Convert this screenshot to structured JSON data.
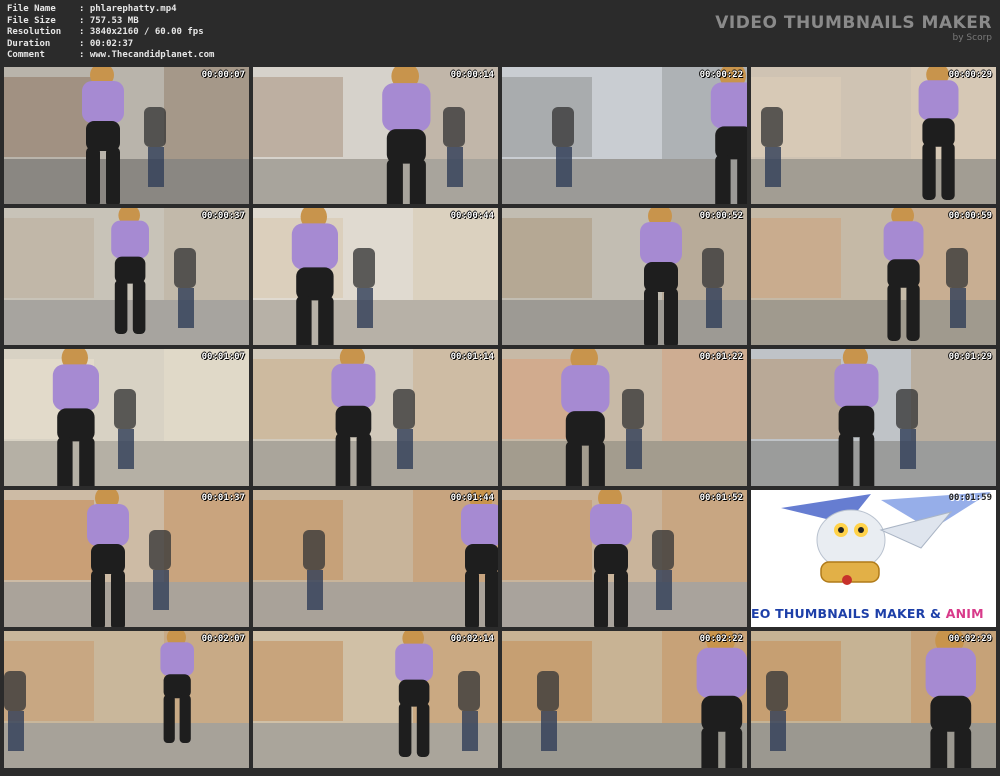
{
  "info": {
    "rows": [
      {
        "key": "File Name",
        "sep": ":",
        "value": "phlarephatty.mp4"
      },
      {
        "key": "File Size",
        "sep": ":",
        "value": "757.53 MB"
      },
      {
        "key": "Resolution",
        "sep": ":",
        "value": "3840x2160 / 60.00 fps"
      },
      {
        "key": "Duration",
        "sep": ":",
        "value": "00:02:37"
      },
      {
        "key": "Comment",
        "sep": ":",
        "value": "www.Thecandidplanet.com"
      }
    ]
  },
  "brand": {
    "title": "VIDEO THUMBNAILS MAKER",
    "subtitle": "by Scorp"
  },
  "thumbnails": [
    {
      "ts": "00:00:07"
    },
    {
      "ts": "00:00:14"
    },
    {
      "ts": "00:00:22"
    },
    {
      "ts": "00:00:29"
    },
    {
      "ts": "00:00:37"
    },
    {
      "ts": "00:00:44"
    },
    {
      "ts": "00:00:52"
    },
    {
      "ts": "00:00:59"
    },
    {
      "ts": "00:01:07"
    },
    {
      "ts": "00:01:14"
    },
    {
      "ts": "00:01:22"
    },
    {
      "ts": "00:01:29"
    },
    {
      "ts": "00:01:37"
    },
    {
      "ts": "00:01:44"
    },
    {
      "ts": "00:01:52"
    },
    {
      "ts": "00:01:59"
    },
    {
      "ts": "00:02:07"
    },
    {
      "ts": "00:02:14"
    },
    {
      "ts": "00:02:22"
    },
    {
      "ts": "00:02:29"
    }
  ],
  "logo": {
    "banner_main": "EO THUMBNAILS MAKER & ",
    "banner_accent": "ANIM"
  },
  "colors": {
    "background": "#2b2b2b",
    "header_text": "#e6e6e6",
    "brand_text": "#8a8a8a",
    "hoodie": "#a68ad2",
    "leggings": "#1e1e1e"
  }
}
